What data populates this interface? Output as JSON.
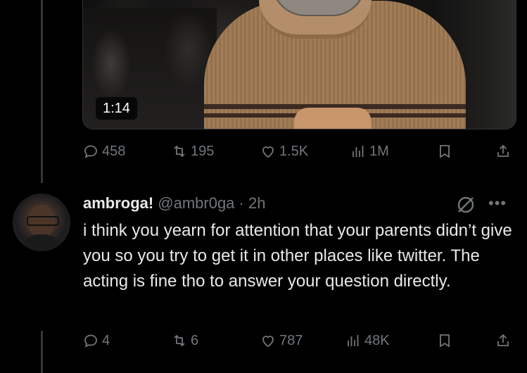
{
  "video": {
    "timestamp": "1:14"
  },
  "main_post_actions": {
    "replies": "458",
    "reposts": "195",
    "likes": "1.5K",
    "views": "1M"
  },
  "reply": {
    "display_name": "ambroga!",
    "handle_and_time": "@ambr0ga · 2h",
    "text": "i think you yearn for attention that your parents didn’t give you so you try to get it in other places like twitter. The acting is fine tho to answer your question directly.",
    "actions": {
      "replies": "4",
      "reposts": "6",
      "likes": "787",
      "views": "48K"
    }
  },
  "icons": [
    "reply-icon",
    "repost-icon",
    "like-icon",
    "views-icon",
    "bookmark-icon",
    "share-icon",
    "grok-icon",
    "more-icon"
  ],
  "colors": {
    "background": "#000000",
    "text": "#e7e9ea",
    "muted": "#71767b"
  }
}
